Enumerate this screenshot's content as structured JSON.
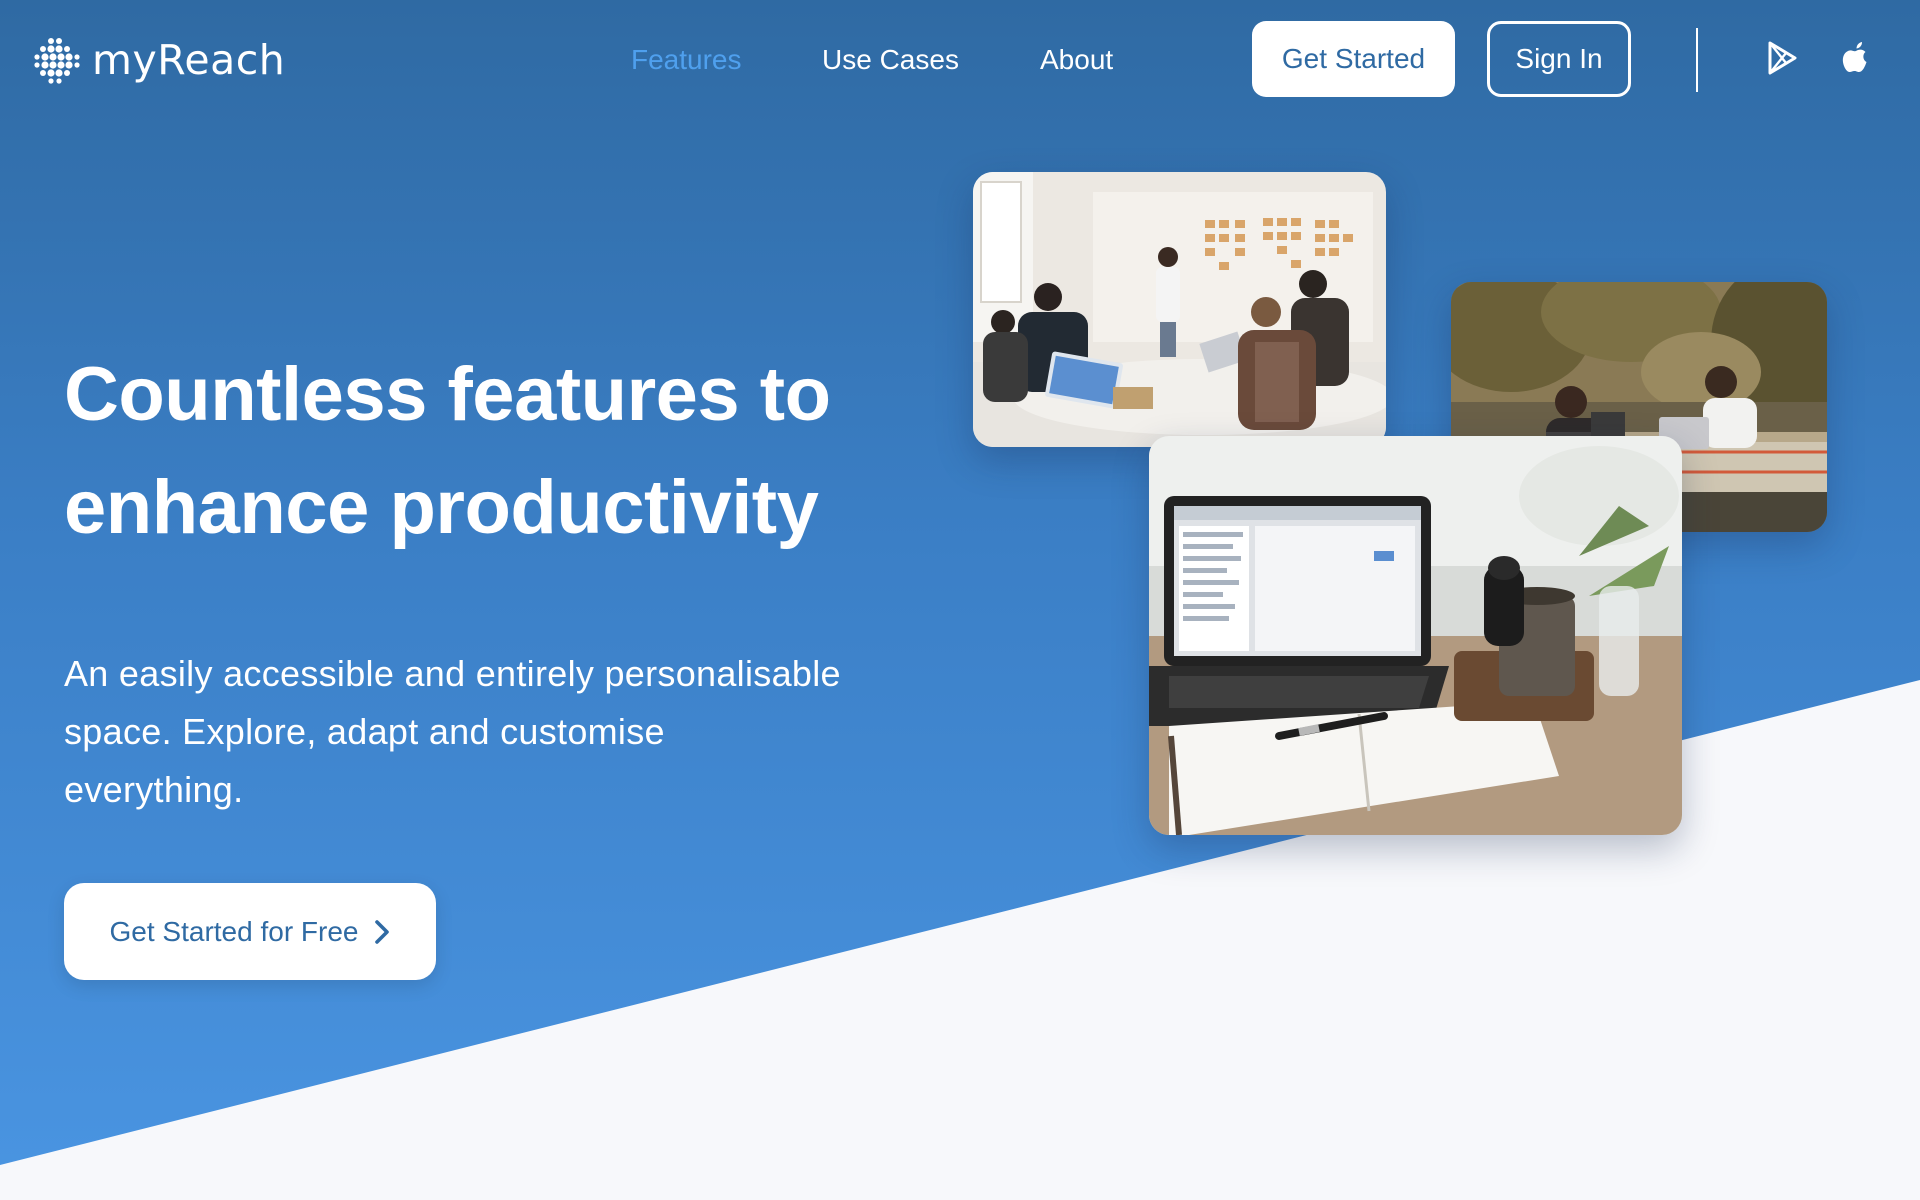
{
  "brand": {
    "name": "myReach"
  },
  "nav": {
    "links": [
      {
        "label": "Features",
        "active": true
      },
      {
        "label": "Use Cases",
        "active": false
      },
      {
        "label": "About",
        "active": false
      }
    ],
    "get_started_label": "Get Started",
    "sign_in_label": "Sign In",
    "store_icons": [
      "google-play-icon",
      "apple-icon"
    ]
  },
  "hero": {
    "title": "Countless features to enhance productivity",
    "subtitle": "An easily accessible and entirely personalisable space. Explore, adapt and customise everything.",
    "cta_label": "Get Started for Free",
    "cta_icon": "chevron-right-icon"
  },
  "images": [
    {
      "name": "team-meeting-photo"
    },
    {
      "name": "outdoor-cafe-photo"
    },
    {
      "name": "laptop-desk-photo"
    }
  ],
  "colors": {
    "gradient_top": "#2f6aa3",
    "gradient_bottom": "#4a95e2",
    "active_link": "#4fa0ee",
    "button_text": "#2f6aa3",
    "light_section": "#f7f8fb"
  }
}
